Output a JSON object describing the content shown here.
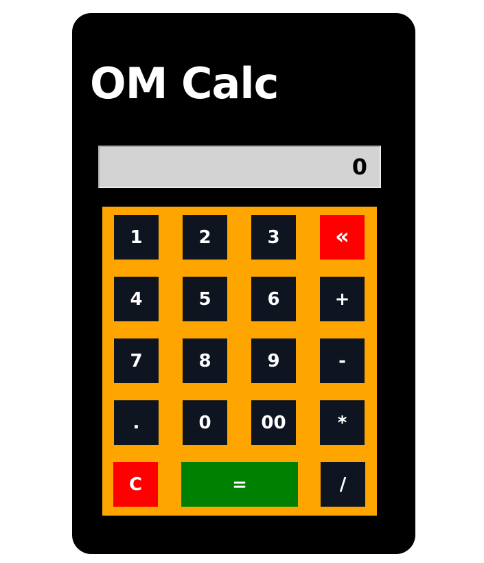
{
  "app": {
    "title": "OM Calc"
  },
  "display": {
    "value": "0"
  },
  "keys": {
    "one": "1",
    "two": "2",
    "three": "3",
    "backspace": "«",
    "four": "4",
    "five": "5",
    "six": "6",
    "plus": "+",
    "seven": "7",
    "eight": "8",
    "nine": "9",
    "minus": "-",
    "dot": ".",
    "zero": "0",
    "double_zero": "00",
    "multiply": "*",
    "clear": "C",
    "equals": "=",
    "divide": "/"
  },
  "colors": {
    "panel": "#000000",
    "keypad": "#ffa500",
    "key": "#0f1421",
    "danger": "#ff0000",
    "equals": "#008000",
    "display": "#d3d3d3"
  },
  "icons": {
    "backspace": "double-chevron-left-icon"
  }
}
